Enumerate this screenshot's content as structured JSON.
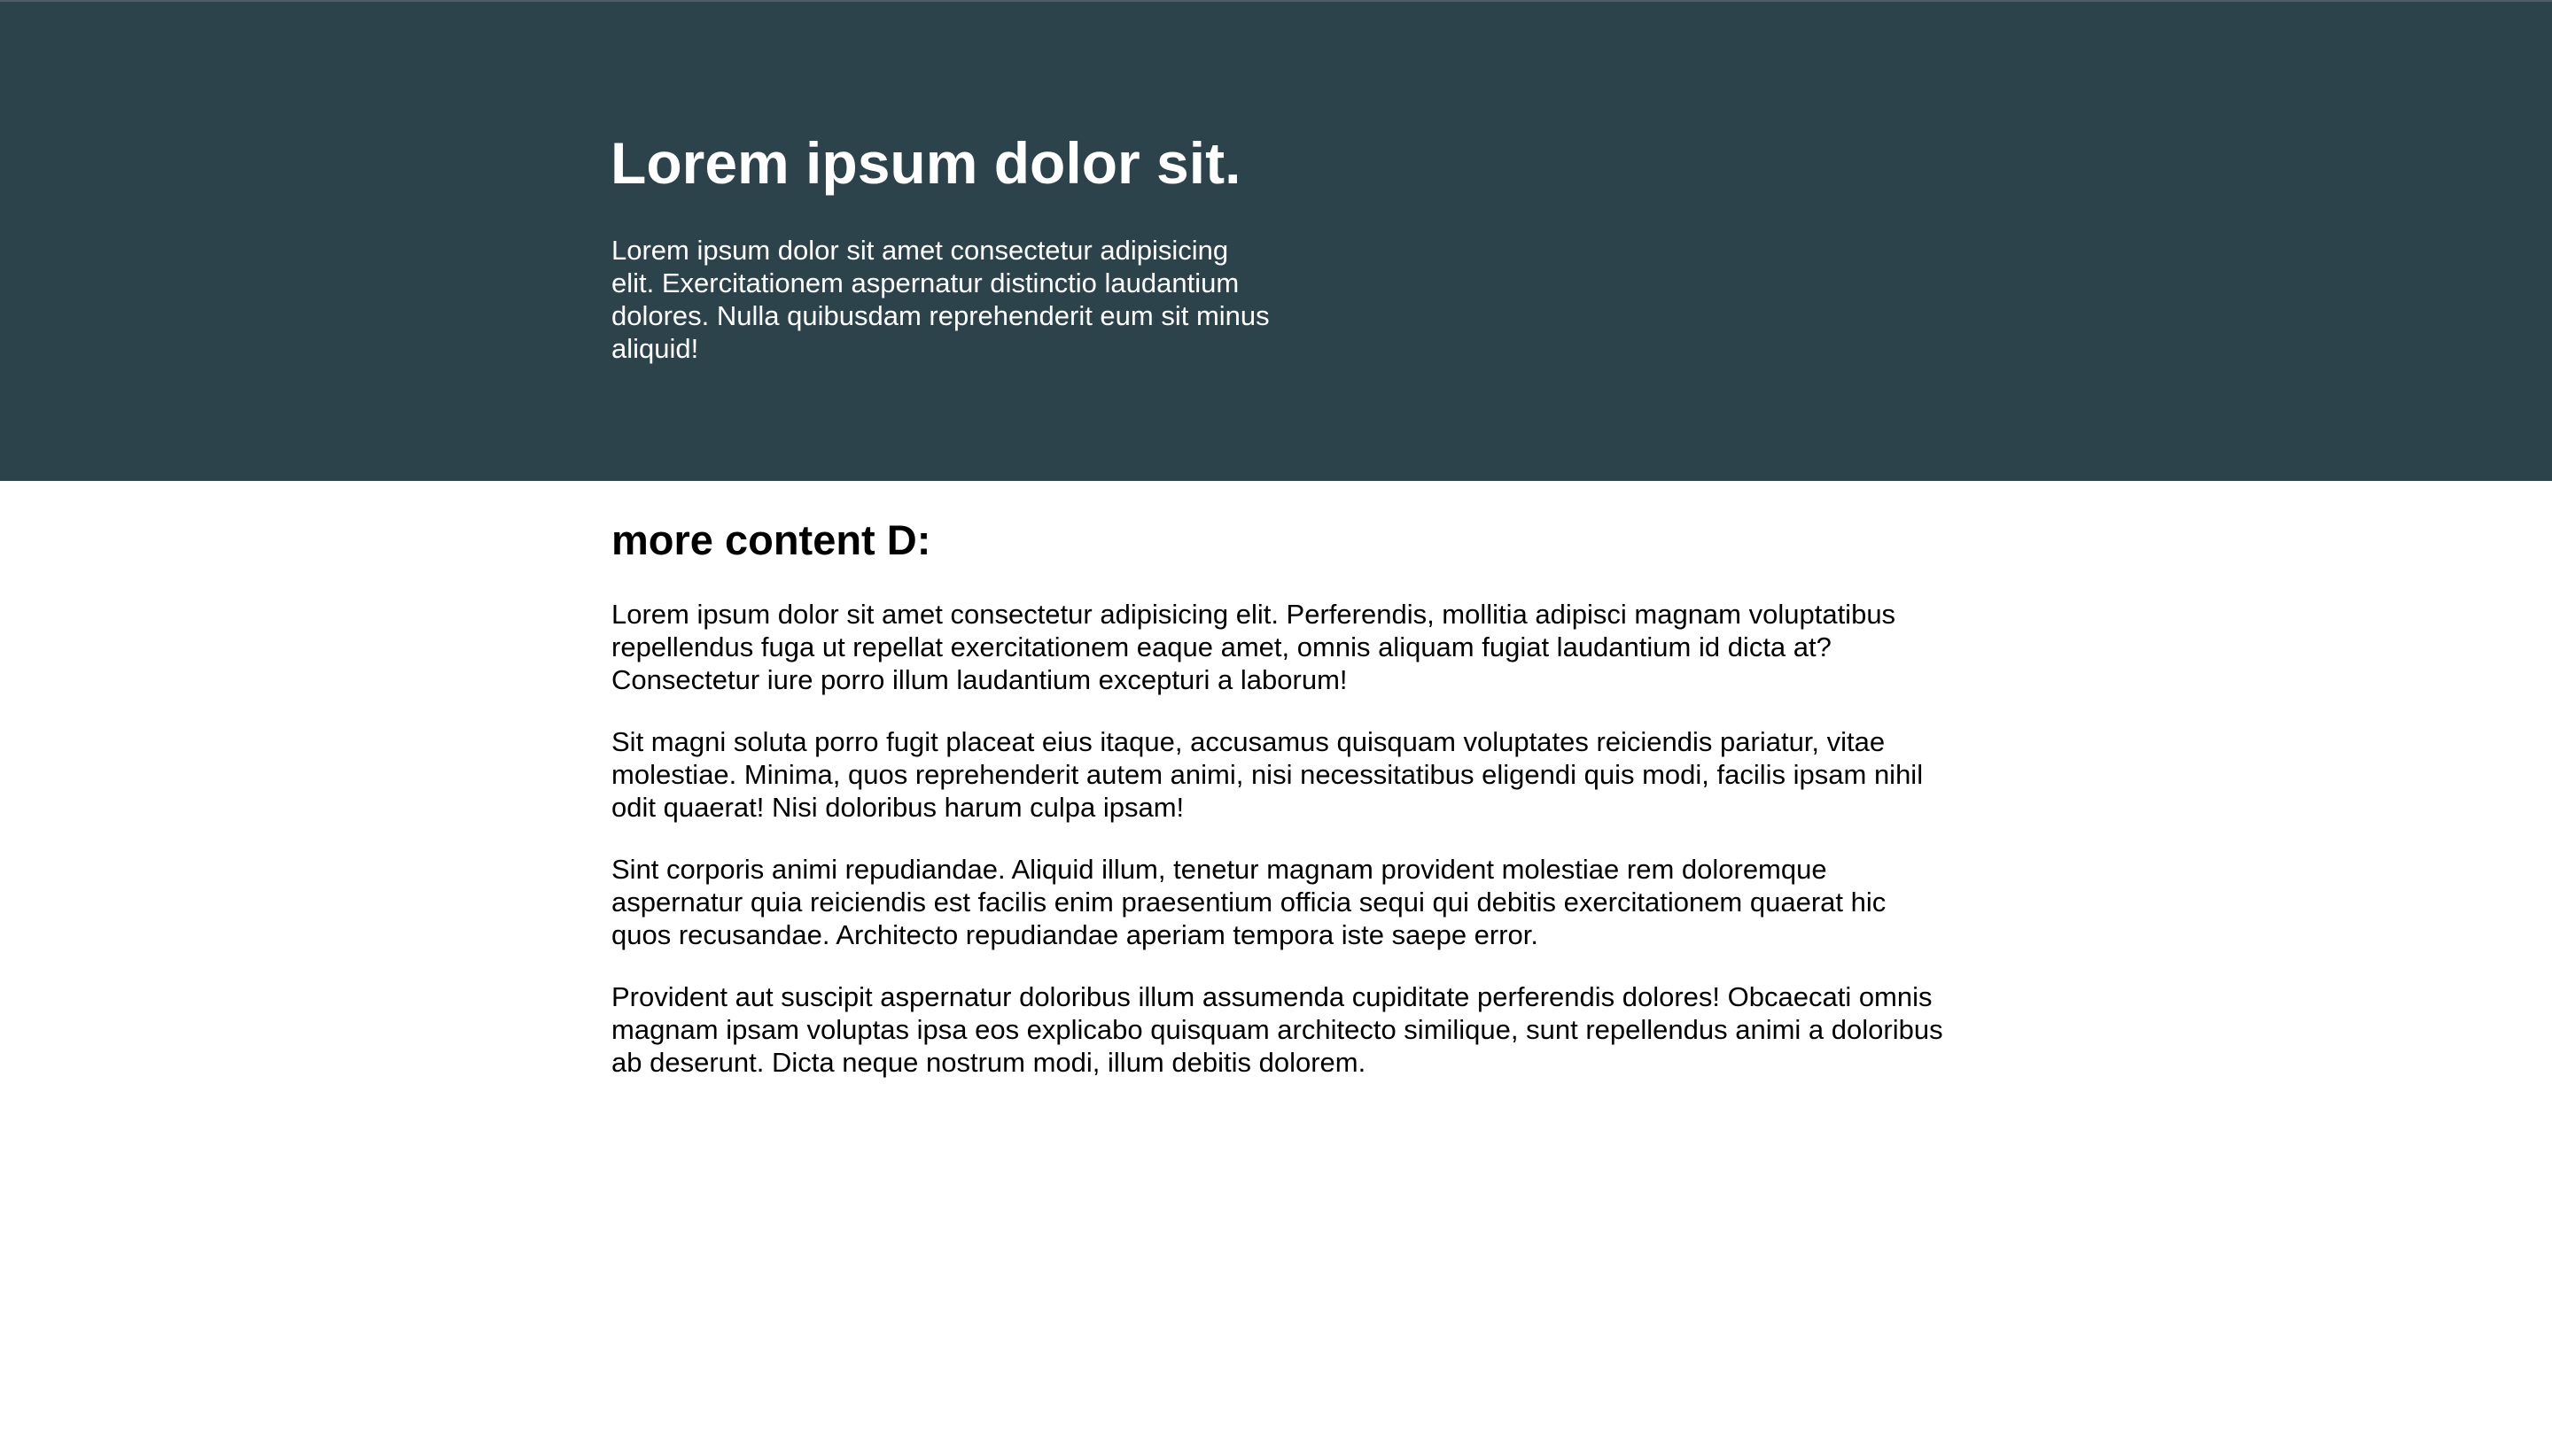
{
  "theme": {
    "hero_background": "#2c434c",
    "hero_text_color": "#ffffff",
    "body_text_color": "#000000"
  },
  "hero": {
    "title": "Lorem ipsum dolor sit.",
    "text": "Lorem ipsum dolor sit amet consectetur adipisicing elit. Exercitationem aspernatur distinctio laudantium dolores. Nulla quibusdam reprehenderit eum sit minus aliquid!"
  },
  "content": {
    "heading": "more content D:",
    "paragraphs": [
      "Lorem ipsum dolor sit amet consectetur adipisicing elit. Perferendis, mollitia adipisci magnam voluptatibus repellendus fuga ut repellat exercitationem eaque amet, omnis aliquam fugiat laudantium id dicta at? Consectetur iure porro illum laudantium excepturi a laborum!",
      "Sit magni soluta porro fugit placeat eius itaque, accusamus quisquam voluptates reiciendis pariatur, vitae molestiae. Minima, quos reprehenderit autem animi, nisi necessitatibus eligendi quis modi, facilis ipsam nihil odit quaerat! Nisi doloribus harum culpa ipsam!",
      "Sint corporis animi repudiandae. Aliquid illum, tenetur magnam provident molestiae rem doloremque aspernatur quia reiciendis est facilis enim praesentium officia sequi qui debitis exercitationem quaerat hic quos recusandae. Architecto repudiandae aperiam tempora iste saepe error.",
      "Provident aut suscipit aspernatur doloribus illum assumenda cupiditate perferendis dolores! Obcaecati omnis magnam ipsam voluptas ipsa eos explicabo quisquam architecto similique, sunt repellendus animi a doloribus ab deserunt. Dicta neque nostrum modi, illum debitis dolorem."
    ]
  }
}
